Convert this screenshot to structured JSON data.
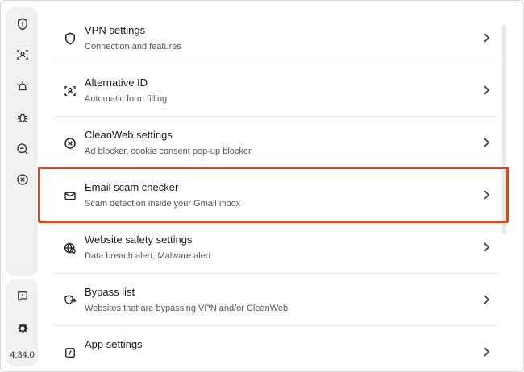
{
  "sidebar": {
    "top_icons": [
      "shield-icon",
      "alternative-id-icon",
      "alert-icon",
      "bug-icon",
      "search-cleanweb-icon",
      "close-circle-icon"
    ],
    "bottom_icons": [
      "feedback-icon",
      "gear-icon"
    ],
    "version": "4.34.0"
  },
  "settings": {
    "items": [
      {
        "title": "VPN settings",
        "subtitle": "Connection and features",
        "icon": "shield-icon"
      },
      {
        "title": "Alternative ID",
        "subtitle": "Automatic form filling",
        "icon": "alternative-id-icon"
      },
      {
        "title": "CleanWeb settings",
        "subtitle": "Ad blocker, cookie consent pop-up blocker",
        "icon": "cleanweb-icon"
      },
      {
        "title": "Email scam checker",
        "subtitle": "Scam detection inside your Gmail inbox",
        "icon": "email-icon"
      },
      {
        "title": "Website safety settings",
        "subtitle": "Data breach alert, Malware alert",
        "icon": "website-safety-icon"
      },
      {
        "title": "Bypass list",
        "subtitle": "Websites that are bypassing VPN and/or CleanWeb",
        "icon": "bypass-icon"
      },
      {
        "title": "App settings",
        "subtitle": "",
        "icon": "app-settings-icon"
      }
    ]
  },
  "colors": {
    "highlight": "#d84b20",
    "sidebar_bg": "#f1f1f1",
    "divider": "#e6e6e6"
  }
}
